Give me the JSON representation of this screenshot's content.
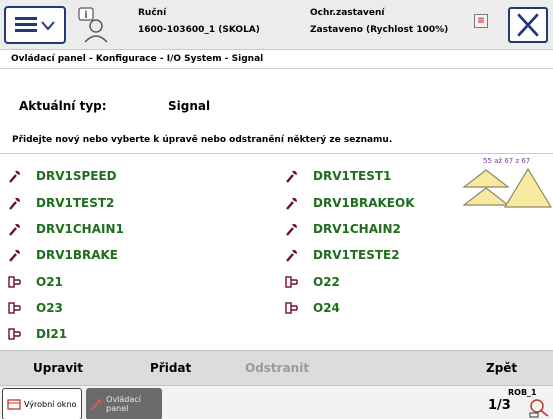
{
  "header": {
    "menu_icon": "hamburger-menu-icon",
    "status_icon": "operator-info-icon",
    "mode": "Ruční",
    "controller": "1600-103600_1 (SKOLA)",
    "state_title": "Ochr.zastavení",
    "state_value": "Zastaveno (Rychlost 100%)",
    "close_icon": "close-icon"
  },
  "breadcrumb": "Ovládací panel - Konfigurace - I/O System - Signal",
  "current_type": {
    "label": "Aktuální typ:",
    "value": "Signal"
  },
  "instruction": "Přidejte nový nebo vyberte k úpravě nebo odstranění některý ze seznamu.",
  "page_counter": "55 až 67 z 67",
  "list": {
    "left": [
      {
        "label": "DRV1SPEED",
        "icon": "wrench-icon"
      },
      {
        "label": "DRV1TEST2",
        "icon": "wrench-icon"
      },
      {
        "label": "DRV1CHAIN1",
        "icon": "wrench-icon"
      },
      {
        "label": "DRV1BRAKE",
        "icon": "wrench-icon"
      },
      {
        "label": "O21",
        "icon": "io-signal-icon"
      },
      {
        "label": "O23",
        "icon": "io-signal-icon"
      },
      {
        "label": "DI21",
        "icon": "io-signal-icon"
      }
    ],
    "right": [
      {
        "label": "DRV1TEST1",
        "icon": "wrench-icon"
      },
      {
        "label": "DRV1BRAKEOK",
        "icon": "wrench-icon"
      },
      {
        "label": "DRV1CHAIN2",
        "icon": "wrench-icon"
      },
      {
        "label": "DRV1TESTE2",
        "icon": "wrench-icon"
      },
      {
        "label": "O22",
        "icon": "io-signal-icon"
      },
      {
        "label": "O24",
        "icon": "io-signal-icon"
      }
    ]
  },
  "bottom_bar": {
    "edit": "Upravit",
    "add": "Přidat",
    "delete": "Odstranit",
    "back": "Zpět"
  },
  "taskbar": {
    "production_window": "Výrobní okno",
    "control_panel": "Ovládací panel",
    "rob_label": "ROB_1",
    "increment_fraction": "1/3"
  },
  "colors": {
    "accent_blue": "#203a78",
    "signal_green": "#1e6e1e",
    "icon_maroon": "#6b1028",
    "scroll_yellow": "#f7eaa0"
  }
}
